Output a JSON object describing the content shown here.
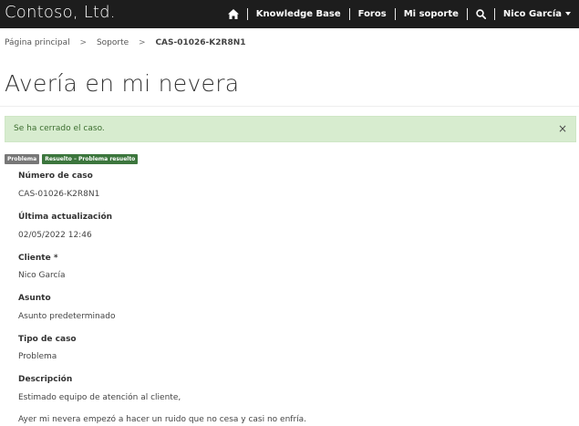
{
  "header": {
    "brand": "Contoso, Ltd.",
    "nav": {
      "home_icon": "home-icon",
      "knowledge_base": "Knowledge Base",
      "foros": "Foros",
      "mi_soporte": "Mi soporte",
      "search_icon": "search-icon",
      "user": "Nico García"
    }
  },
  "breadcrumb": {
    "items": [
      "Página principal",
      "Soporte"
    ],
    "current": "CAS-01026-K2R8N1"
  },
  "page": {
    "title": "Avería en mi nevera"
  },
  "alert": {
    "message": "Se ha cerrado el caso.",
    "close": "×"
  },
  "badges": {
    "type": "Problema",
    "status": "Resuelto – Problema resuelto"
  },
  "fields": [
    {
      "label": "Número de caso",
      "value": "CAS-01026-K2R8N1"
    },
    {
      "label": "Última actualización",
      "value": "02/05/2022 12:46"
    },
    {
      "label": "Cliente *",
      "value": "Nico García"
    },
    {
      "label": "Asunto",
      "value": "Asunto predeterminado"
    },
    {
      "label": "Tipo de caso",
      "value": "Problema"
    },
    {
      "label": "Descripción",
      "value": "Estimado equipo de atención al cliente,"
    }
  ],
  "description_line2": "Ayer mi nevera empezó a hacer un ruido que no cesa y casi no enfría.",
  "colors": {
    "topbar": "#1d1d1d",
    "alert_bg": "#d7eccf",
    "badge_gray": "#777777",
    "badge_green": "#3c763d"
  }
}
